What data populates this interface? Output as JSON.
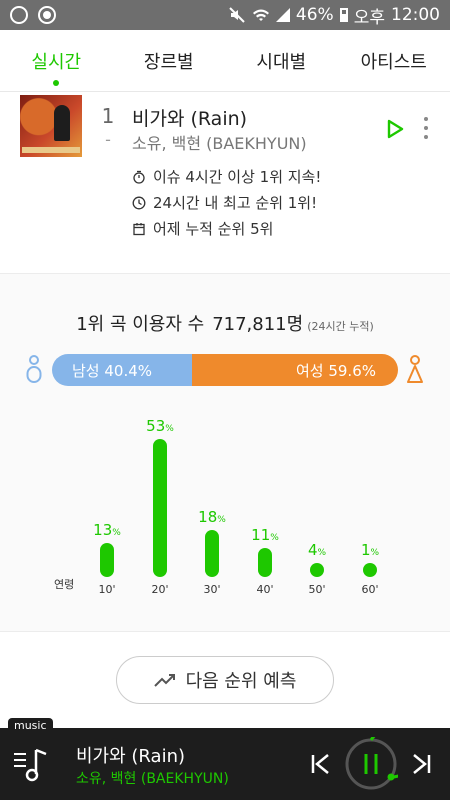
{
  "statusbar": {
    "battery": "46%",
    "ampm": "오후",
    "time": "12:00"
  },
  "tabs": [
    {
      "label": "실시간",
      "active": true
    },
    {
      "label": "장르별",
      "active": false
    },
    {
      "label": "시대별",
      "active": false
    },
    {
      "label": "아티스트",
      "active": false
    }
  ],
  "song": {
    "rank": "1",
    "rank_change": "-",
    "title": "비가와 (Rain)",
    "artist": "소유, 백현 (BAEKHYUN)",
    "info": [
      {
        "icon": "stopwatch-icon",
        "text": "이슈 4시간 이상 1위 지속!"
      },
      {
        "icon": "clock-icon",
        "text": "24시간 내 최고 순위 1위!"
      },
      {
        "icon": "calendar-icon",
        "text": "어제 누적 순위 5위"
      }
    ]
  },
  "stats": {
    "users_label": "1위 곡 이용자 수",
    "users_count": "717,811명",
    "users_note": "(24시간 누적)",
    "male_label": "남성 40.4%",
    "female_label": "여성 59.6%",
    "male_ratio": 0.404,
    "age_axis_label": "연령"
  },
  "chart_data": {
    "type": "bar",
    "categories": [
      "10'",
      "20'",
      "30'",
      "40'",
      "50'",
      "60'"
    ],
    "values": [
      13,
      53,
      18,
      11,
      4,
      1
    ],
    "unit": "%",
    "color": "#1ec800"
  },
  "predict_button": {
    "label": "다음 순위 예측"
  },
  "player": {
    "tag": "music",
    "title": "비가와 (Rain)",
    "artist": "소유, 백현 (BAEKHYUN)"
  },
  "colors": {
    "accent": "#1ec800",
    "male": "#86b5e9",
    "female": "#ef8a2c"
  }
}
